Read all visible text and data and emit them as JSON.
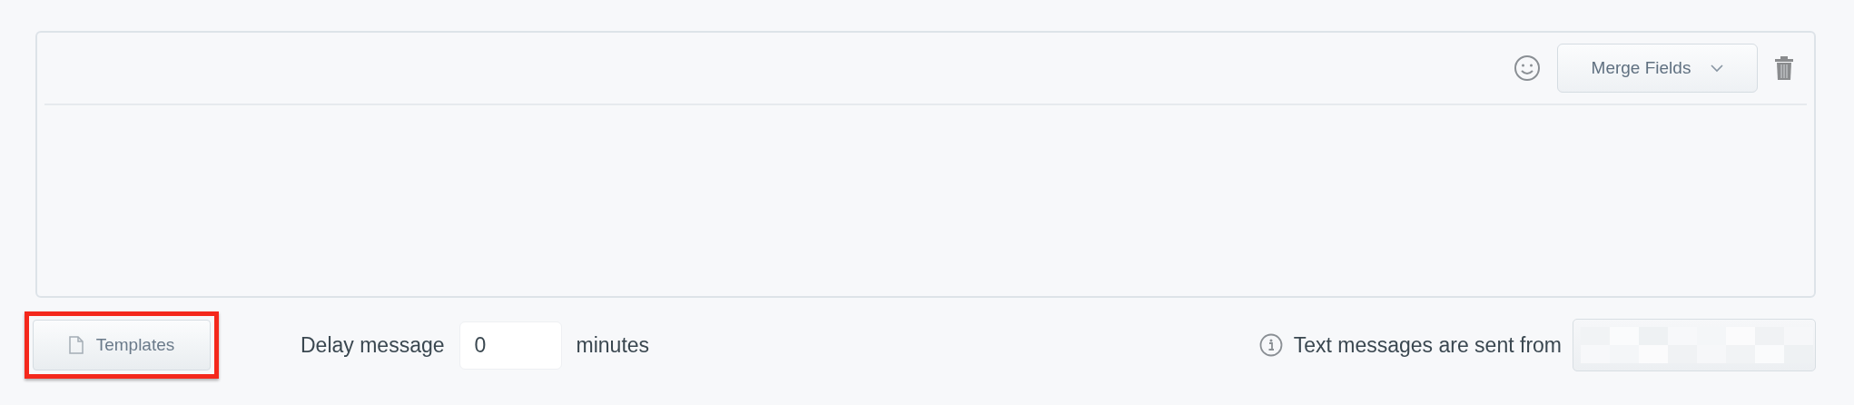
{
  "editor": {
    "merge_fields_button": "Merge Fields"
  },
  "templates_button": {
    "label": "Templates",
    "highlighted": true
  },
  "delay": {
    "label": "Delay message",
    "value": "0",
    "unit": "minutes"
  },
  "sender": {
    "label": "Text messages are sent from",
    "blurred": true
  }
}
